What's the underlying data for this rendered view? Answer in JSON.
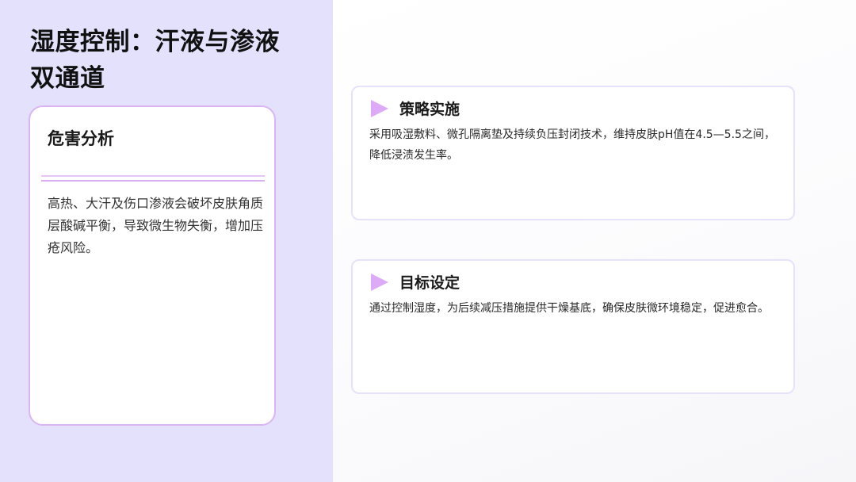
{
  "page": {
    "title": "湿度控制：汗液与渗液双通道"
  },
  "hazard": {
    "heading": "危害分析",
    "body": "高热、大汗及伤口渗液会破坏皮肤角质层酸碱平衡，导致微生物失衡，增加压疮风险。"
  },
  "cards": [
    {
      "icon": "play-triangle-icon",
      "heading": "策略实施",
      "body": "采用吸湿敷料、微孔隔离垫及持续负压封闭技术，维持皮肤pH值在4.5—5.5之间，降低浸渍发生率。"
    },
    {
      "icon": "play-triangle-icon",
      "heading": "目标设定",
      "body": "通过控制湿度，为后续减压措施提供干燥基底，确保皮肤微环境稳定，促进愈合。"
    }
  ],
  "colors": {
    "left_panel_bg": "#e3e1fb",
    "accent_purple": "#dcaaf6",
    "card_border": "#e6e2fb",
    "hazard_border": "#dcb4f3"
  }
}
